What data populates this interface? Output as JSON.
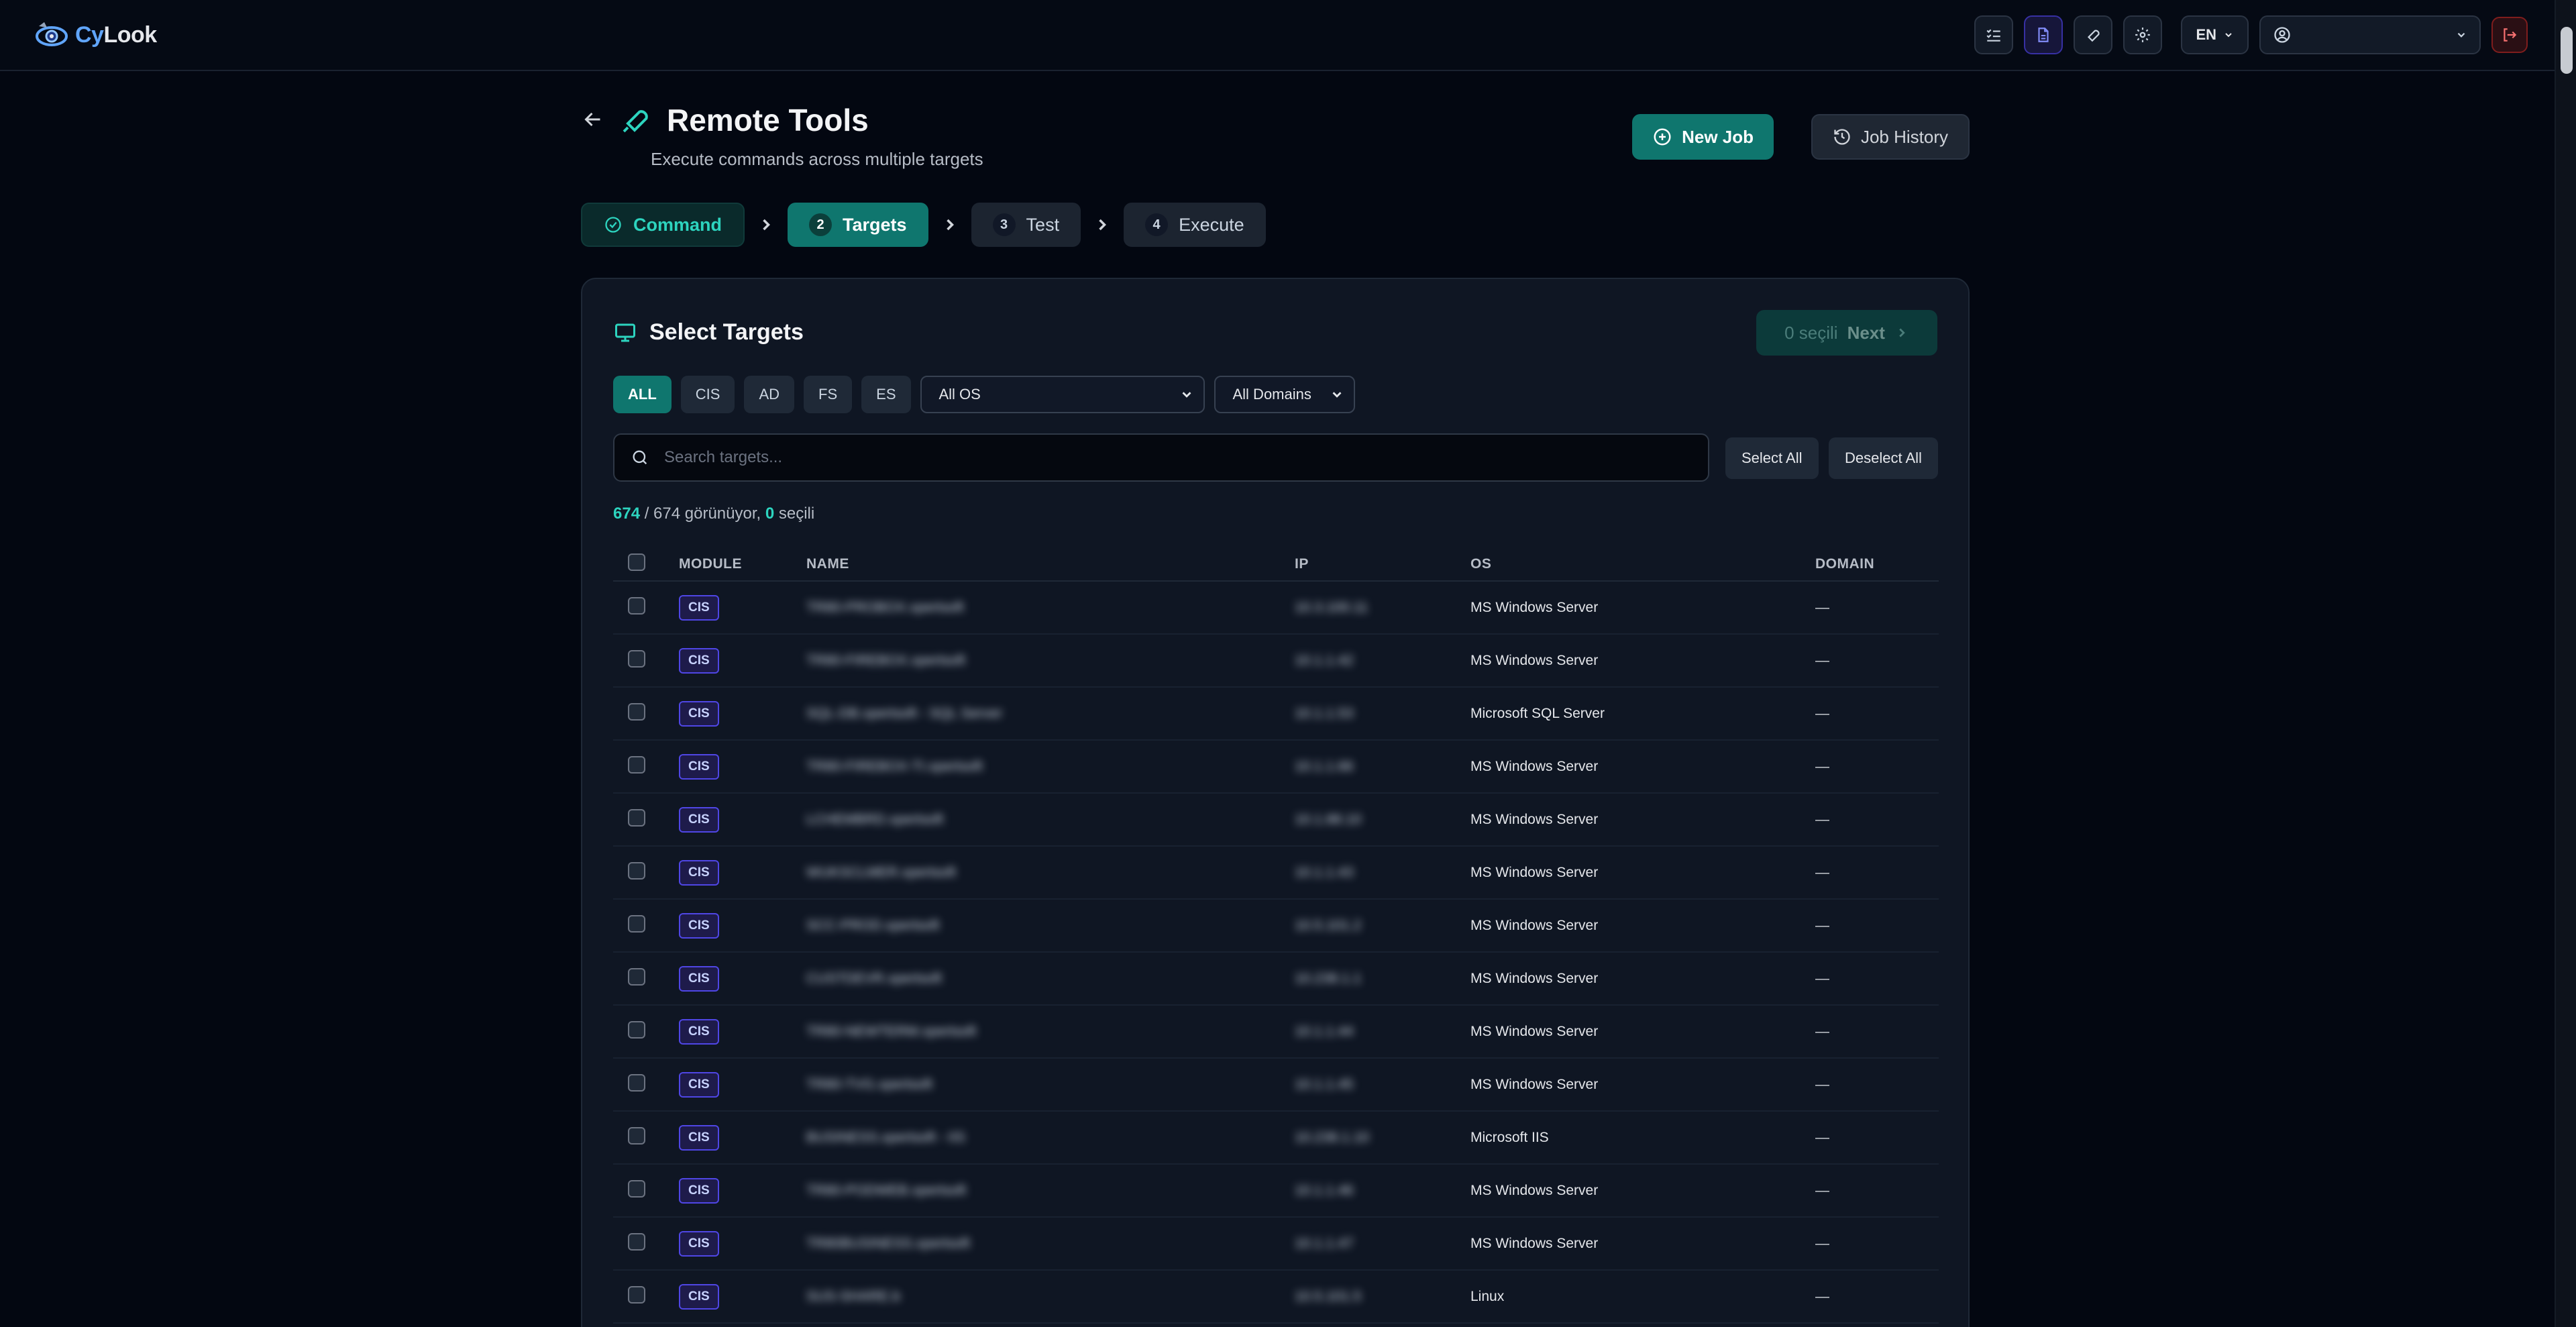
{
  "brand": {
    "name_a": "Cy",
    "name_b": "Look"
  },
  "topbar": {
    "language": "EN",
    "user_label": ""
  },
  "header": {
    "title": "Remote Tools",
    "subtitle": "Execute commands across multiple targets",
    "new_job": "New Job",
    "job_history": "Job History"
  },
  "steps": [
    {
      "num": "",
      "label": "Command",
      "state": "done"
    },
    {
      "num": "2",
      "label": "Targets",
      "state": "current"
    },
    {
      "num": "3",
      "label": "Test",
      "state": "todo"
    },
    {
      "num": "4",
      "label": "Execute",
      "state": "todo"
    }
  ],
  "card": {
    "title": "Select Targets",
    "next_count": "0 seçili",
    "next_label": "Next"
  },
  "filters": {
    "modules": [
      "ALL",
      "CIS",
      "AD",
      "FS",
      "ES"
    ],
    "os_select": "All OS",
    "domain_select": "All Domains"
  },
  "search": {
    "placeholder": "Search targets..."
  },
  "buttons": {
    "select_all": "Select All",
    "deselect_all": "Deselect All"
  },
  "counter": {
    "visible": "674",
    "total_text": " / 674 görünüyor, ",
    "selected": "0",
    "selected_suffix": " seçili"
  },
  "table": {
    "headers": [
      "MODULE",
      "NAME",
      "IP",
      "OS",
      "DOMAIN"
    ],
    "rows": [
      {
        "module": "CIS",
        "name": "TR80-PROBOX.xpertsoft",
        "ip": "10.3.100.11",
        "os": "MS Windows Server",
        "domain": "—"
      },
      {
        "module": "CIS",
        "name": "TR80-FIREBOX.xpertsoft",
        "ip": "10.1.1.42",
        "os": "MS Windows Server",
        "domain": "—"
      },
      {
        "module": "CIS",
        "name": "SQL-DB.xpertsoft - SQL Server",
        "ip": "10.1.1.53",
        "os": "Microsoft SQL Server",
        "domain": "—"
      },
      {
        "module": "CIS",
        "name": "TR80-FIREBOX-TI.xpertsoft",
        "ip": "10.1.1.66",
        "os": "MS Windows Server",
        "domain": "—"
      },
      {
        "module": "CIS",
        "name": "LCHEMBRD.xpertsoft",
        "ip": "10.1.88.10",
        "os": "MS Windows Server",
        "domain": "—"
      },
      {
        "module": "CIS",
        "name": "WUKSCLMER.xpertsoft",
        "ip": "10.1.1.43",
        "os": "MS Windows Server",
        "domain": "—"
      },
      {
        "module": "CIS",
        "name": "SCC-PROD.xpertsoft",
        "ip": "10.5.101.2",
        "os": "MS Windows Server",
        "domain": "—"
      },
      {
        "module": "CIS",
        "name": "CUSTDEVR.xpertsoft",
        "ip": "10.238.1.1",
        "os": "MS Windows Server",
        "domain": "—"
      },
      {
        "module": "CIS",
        "name": "TR80-NEWTERM.xpertsoft",
        "ip": "10.1.1.44",
        "os": "MS Windows Server",
        "domain": "—"
      },
      {
        "module": "CIS",
        "name": "TR80-TVG.xpertsoft",
        "ip": "10.1.1.45",
        "os": "MS Windows Server",
        "domain": "—"
      },
      {
        "module": "CIS",
        "name": "BUSINESS.xpertsoft - IIS",
        "ip": "10.238.1.10",
        "os": "Microsoft IIS",
        "domain": "—"
      },
      {
        "module": "CIS",
        "name": "TR80-PODWEB.xpertsoft",
        "ip": "10.1.1.46",
        "os": "MS Windows Server",
        "domain": "—"
      },
      {
        "module": "CIS",
        "name": "TR80BUSINESS.xpertsoft",
        "ip": "10.1.1.47",
        "os": "MS Windows Server",
        "domain": "—"
      },
      {
        "module": "CIS",
        "name": "SUS-SHARE.b",
        "ip": "10.5.101.5",
        "os": "Linux",
        "domain": "—"
      }
    ]
  },
  "colors": {
    "accent": "#2dd4bf",
    "primary": "#0f766e",
    "background": "#030711"
  }
}
